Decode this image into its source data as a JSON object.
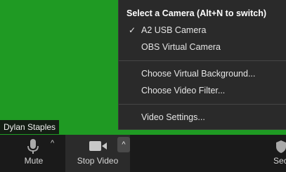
{
  "participant": {
    "name": "Dylan Staples"
  },
  "toolbar": {
    "mute_label": "Mute",
    "stop_video_label": "Stop Video",
    "security_label_partial": "Sec"
  },
  "camera_menu": {
    "header": "Select a Camera (Alt+N to switch)",
    "cameras": [
      {
        "label": "A2 USB Camera",
        "selected": true
      },
      {
        "label": "OBS Virtual Camera",
        "selected": false
      }
    ],
    "actions": [
      {
        "label": "Choose Virtual Background..."
      },
      {
        "label": "Choose Video Filter..."
      }
    ],
    "settings": {
      "label": "Video Settings..."
    }
  },
  "colors": {
    "video_background": "#1f9a23",
    "menu_background": "#2a2a2a",
    "toolbar_background": "#1a1a1a"
  }
}
